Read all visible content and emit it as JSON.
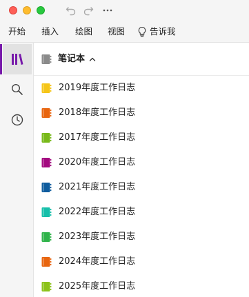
{
  "titlebar": {
    "buttons": [
      "close-button",
      "minimize-button",
      "zoom-button"
    ],
    "toolbar_icons": [
      "undo-icon",
      "redo-icon",
      "more-icon"
    ]
  },
  "menu": {
    "items": [
      "开始",
      "插入",
      "绘图",
      "视图",
      "告诉我"
    ],
    "tell_me_icon": "lightbulb-icon"
  },
  "sidebar": {
    "buttons": [
      {
        "icon": "notebooks-icon",
        "active": true
      },
      {
        "icon": "search-icon",
        "active": false
      },
      {
        "icon": "recent-clock-icon",
        "active": false
      }
    ],
    "accent": "#7719aa"
  },
  "notebooks": {
    "header": "笔记本",
    "header_icon_color": "#8a8a8a",
    "items": [
      {
        "label": "2019年度工作日志",
        "color": "#f5c518"
      },
      {
        "label": "2018年度工作日志",
        "color": "#e8650f"
      },
      {
        "label": "2017年度工作日志",
        "color": "#78b919"
      },
      {
        "label": "2020年度工作日志",
        "color": "#a3097f"
      },
      {
        "label": "2021年度工作日志",
        "color": "#0e5c9e"
      },
      {
        "label": "2022年度工作日志",
        "color": "#16bfaa"
      },
      {
        "label": "2023年度工作日志",
        "color": "#2fb34a"
      },
      {
        "label": "2024年度工作日志",
        "color": "#e8650f"
      },
      {
        "label": "2025年度工作日志",
        "color": "#8cc21a"
      }
    ]
  }
}
